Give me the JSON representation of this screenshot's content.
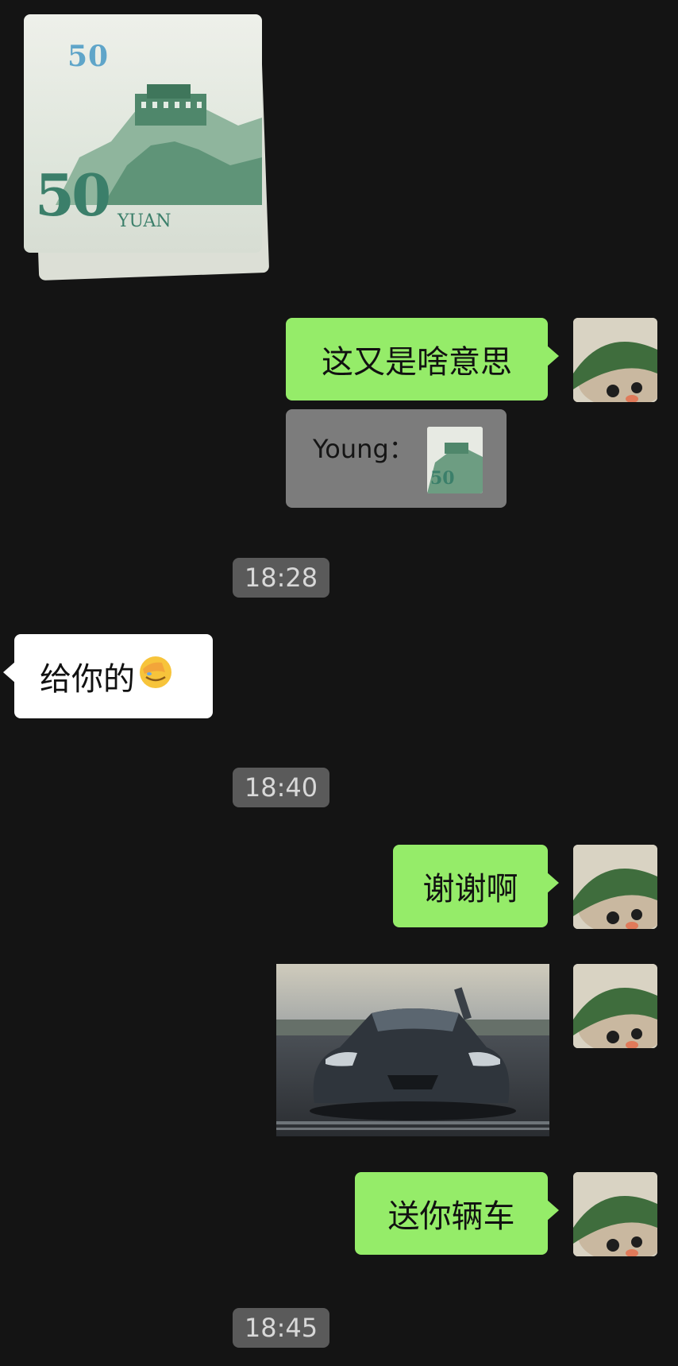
{
  "chat": {
    "messages": [
      {
        "type": "image",
        "side": "incoming",
        "content": "banknote-50-yuan-image",
        "denomination": "50",
        "currency_label": "YUAN"
      },
      {
        "type": "text",
        "side": "outgoing",
        "text": "这又是啥意思"
      },
      {
        "type": "quote",
        "side": "outgoing",
        "sender": "Young：",
        "thumbnail": "banknote-thumbnail"
      },
      {
        "type": "time",
        "text": "18:28"
      },
      {
        "type": "text",
        "side": "incoming",
        "text": "给你的",
        "emoji": "facepalm-emoji"
      },
      {
        "type": "time",
        "text": "18:40"
      },
      {
        "type": "text",
        "side": "outgoing",
        "text": "谢谢啊"
      },
      {
        "type": "image",
        "side": "outgoing",
        "content": "sports-car-image"
      },
      {
        "type": "text",
        "side": "outgoing",
        "text": "送你辆车"
      },
      {
        "type": "time",
        "text": "18:45"
      }
    ]
  },
  "colors": {
    "background": "#141414",
    "outgoing_bubble": "#95ec69",
    "incoming_bubble": "#ffffff",
    "quote_bubble": "#7c7c7c",
    "timestamp_bg": "#5a5a5a"
  }
}
